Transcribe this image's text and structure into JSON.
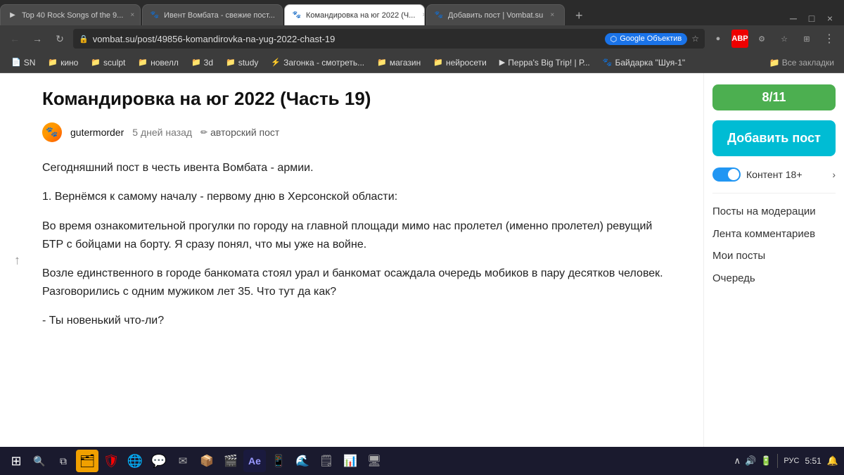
{
  "browser": {
    "tabs": [
      {
        "id": "tab1",
        "label": "Top 40 Rock Songs of the 9...",
        "favicon": "▶",
        "active": false,
        "url": "youtube.com"
      },
      {
        "id": "tab2",
        "label": "Ивент Вомбата - свежие пост...",
        "favicon": "🐾",
        "active": false,
        "url": "vombat.su"
      },
      {
        "id": "tab3",
        "label": "Командировка на юг 2022 (Ч...",
        "favicon": "🐾",
        "active": true,
        "url": "vombat.su"
      },
      {
        "id": "tab4",
        "label": "Добавить пост | Vombat.su",
        "favicon": "🐾",
        "active": false,
        "url": "vombat.su"
      }
    ],
    "address": "vombat.su/post/49856-komandirovka-na-yug-2022-chast-19",
    "google_lens": "Google Объектив",
    "bookmarks": [
      {
        "label": "SN",
        "icon": "📄"
      },
      {
        "label": "кино",
        "icon": "📁"
      },
      {
        "label": "sculpt",
        "icon": "📁"
      },
      {
        "label": "новелл",
        "icon": "📁"
      },
      {
        "label": "3d",
        "icon": "📁"
      },
      {
        "label": "study",
        "icon": "📁"
      },
      {
        "label": "Загонка - смотреть...",
        "icon": "⚡"
      },
      {
        "label": "магазин",
        "icon": "📁"
      },
      {
        "label": "нейросети",
        "icon": "📁"
      },
      {
        "label": "Перра's Big Trip! | Р...",
        "icon": "▶"
      },
      {
        "label": "Байдарка \"Шуя-1\"",
        "icon": "🐾"
      },
      {
        "label": "Все закладки",
        "icon": "📁"
      }
    ]
  },
  "article": {
    "title": "Командировка на юг 2022 (Часть 19)",
    "author": "gutermorder",
    "date": "5 дней назад",
    "post_type": "авторский пост",
    "paragraphs": [
      "Сегодняшний пост в честь ивента Вомбата - армии.",
      "1. Вернёмся к самому началу - первому дню в Херсонской области:",
      "Во время ознакомительной прогулки по городу на главной площади мимо нас пролетел (именно пролетел) ревущий БТР с бойцами на борту. Я сразу понял, что мы уже на войне.",
      "Возле единственного в городе банкомата стоял урал и банкомат осаждала очередь мобиков в пару десятков человек. Разговорились с одним мужиком лет 35. Что тут да как?",
      "- Ты новенький что-ли?"
    ]
  },
  "sidebar": {
    "progress": "8/11",
    "add_post_label": "Добавить пост",
    "content_label": "Контент 18+",
    "links": [
      "Посты на модерации",
      "Лента комментариев",
      "Мои посты",
      "Очередь"
    ]
  },
  "taskbar": {
    "windows_icon": "⊞",
    "search_icon": "🔍",
    "apps": [
      {
        "icon": "🗂",
        "name": "file-explorer"
      },
      {
        "icon": "🔴",
        "name": "antivirus"
      },
      {
        "icon": "🌐",
        "name": "browser"
      },
      {
        "icon": "💬",
        "name": "whatsapp"
      },
      {
        "icon": "📧",
        "name": "email"
      },
      {
        "icon": "📦",
        "name": "app6"
      },
      {
        "icon": "🎬",
        "name": "media"
      },
      {
        "icon": "🎨",
        "name": "after-effects"
      },
      {
        "icon": "📱",
        "name": "app9"
      },
      {
        "icon": "🌊",
        "name": "app10"
      },
      {
        "icon": "🗒",
        "name": "notepad"
      },
      {
        "icon": "📊",
        "name": "app12"
      },
      {
        "icon": "🖥",
        "name": "app13"
      }
    ],
    "tray": {
      "lang": "РУС",
      "time": "5:51"
    }
  }
}
